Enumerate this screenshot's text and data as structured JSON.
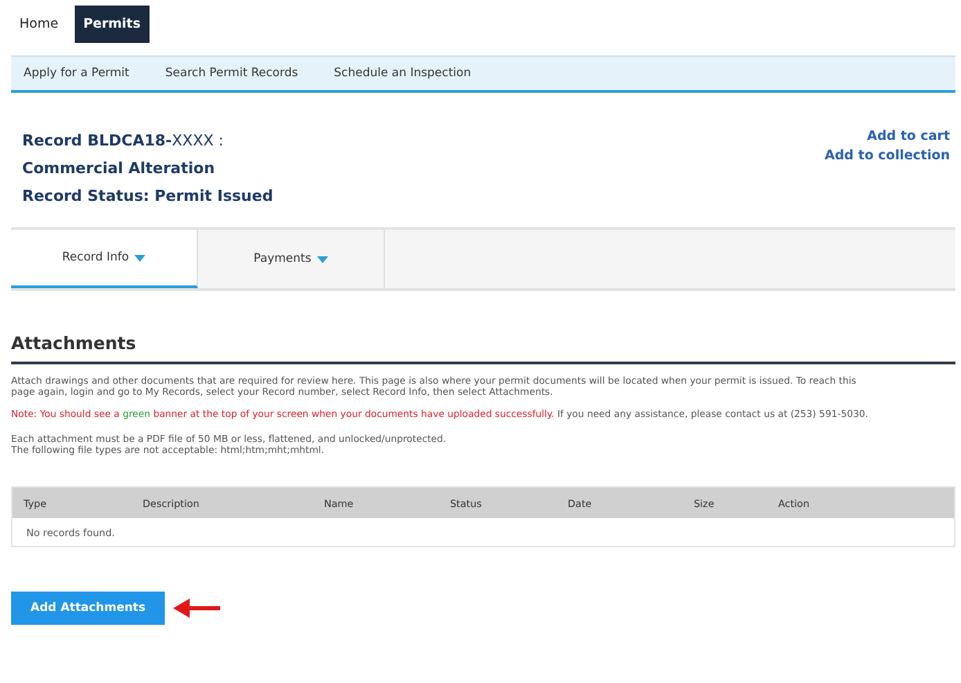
{
  "top_nav": [
    {
      "label": "Home",
      "selected": false
    },
    {
      "label": "Permits",
      "selected": true
    }
  ],
  "sub_nav": [
    "Apply for a Permit",
    "Search Permit Records",
    "Schedule an Inspection"
  ],
  "record": {
    "title": "**Record BLDCA18-**XXXX :",
    "type": "Commercial Alteration",
    "status": "Record Status: Permit Issued"
  },
  "record_links": [
    "Add to cart",
    "Add to collection"
  ],
  "tabs": [
    {
      "label": "Record Info",
      "selected": true
    },
    {
      "label": "Payments",
      "selected": false
    }
  ],
  "section_title": "Attachments",
  "intro": "Attach drawings and other documents that are required for review here. This page is also where your permit documents will be located when your permit is issued. To reach this page again, login and go to My Records, select your Record number, select Record Info, then select Attachments.",
  "note": [
    {
      "text": "Note: You should see a ",
      "color": "#e0202a"
    },
    {
      "text": "green",
      "color": "#2e9a3a"
    },
    {
      "text": " banner at the top of your screen when your documents have uploaded successfully.",
      "color": "#e0202a"
    },
    {
      "text": " If you need any assistance, please contact us at (253) 591-5030.",
      "color": "#555555"
    }
  ],
  "requirements": [
    "Each attachment must be a PDF file of 50 MB or less, flattened, and unlocked/unprotected.",
    "The following file types are not acceptable: html;htm;mht;mhtml."
  ],
  "table": {
    "columns": [
      "Type",
      "Description",
      "Name",
      "Status",
      "Date",
      "Size",
      "Action"
    ],
    "empty_message": "No records found."
  },
  "add_button": "Add Attachments"
}
